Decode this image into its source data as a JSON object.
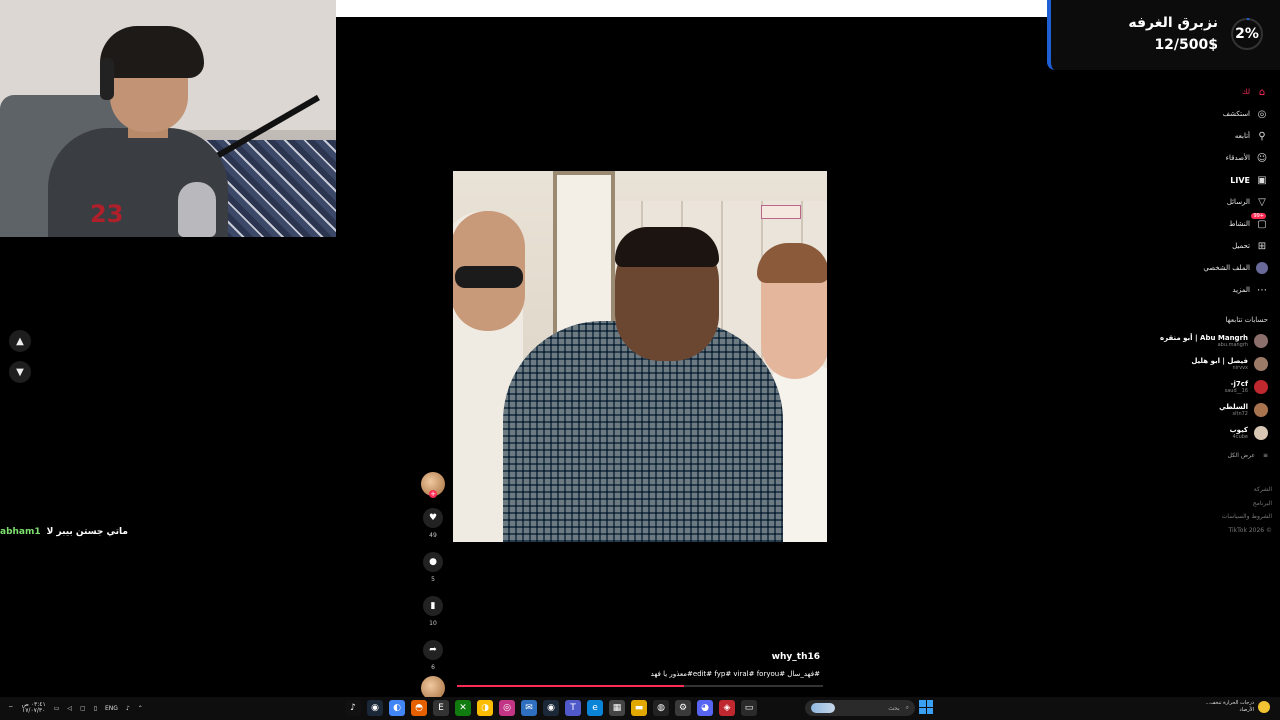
{
  "overlay": {
    "goal_title": "نزبرق الغرفه",
    "goal_amount": "12/500$",
    "goal_percent": "2%",
    "goal_progress": 0.024
  },
  "chat": {
    "username": "abham1",
    "message": "ماتي جستن بيبر لا"
  },
  "video": {
    "author": "why_th16",
    "caption": "معذور يا فهد#edit# fyp# viral# foryou# فهد_سال#",
    "progress": 0.62,
    "likes": "49",
    "comments": "5",
    "saves": "10",
    "shares": "6"
  },
  "sidebar": {
    "items": [
      {
        "label": "لك",
        "icon": "home-icon"
      },
      {
        "label": "استكشف",
        "icon": "compass-icon"
      },
      {
        "label": "أتابعه",
        "icon": "following-icon"
      },
      {
        "label": "الأصدقاء",
        "icon": "friends-icon"
      },
      {
        "label": "LIVE",
        "icon": "live-icon"
      },
      {
        "label": "الرسائل",
        "icon": "send-icon"
      },
      {
        "label": "النشاط",
        "icon": "activity-icon",
        "badge": "99+"
      },
      {
        "label": "تحميل",
        "icon": "upload-icon"
      },
      {
        "label": "الملف الشخصي",
        "icon": "profile-icon"
      },
      {
        "label": "المزيد",
        "icon": "more-icon"
      }
    ],
    "following_title": "حسابات تتابعها",
    "following": [
      {
        "name": "Abu Mangrh | أبو منقره",
        "handle": "abu.mangrh"
      },
      {
        "name": "فيصل | ابو هليل",
        "handle": "nirvvx"
      },
      {
        "name": "j7cf-",
        "handle": "saud__16"
      },
      {
        "name": "السلطي",
        "handle": "sltn72"
      },
      {
        "name": "كيوب",
        "handle": "4cube"
      }
    ],
    "show_all": "عرض الكل",
    "footer": [
      "الشركة",
      "البرنامج",
      "الشروط والسياسات",
      "TikTok 2026 ©"
    ]
  },
  "taskbar": {
    "lang": "ENG",
    "time": "٠٣:٤١ ص",
    "date": "١٧/٠٧/٣٠",
    "search_placeholder": "بحث",
    "weather": "درجات الحرارة تنخف...",
    "weather_sub": "الأرصاد"
  }
}
